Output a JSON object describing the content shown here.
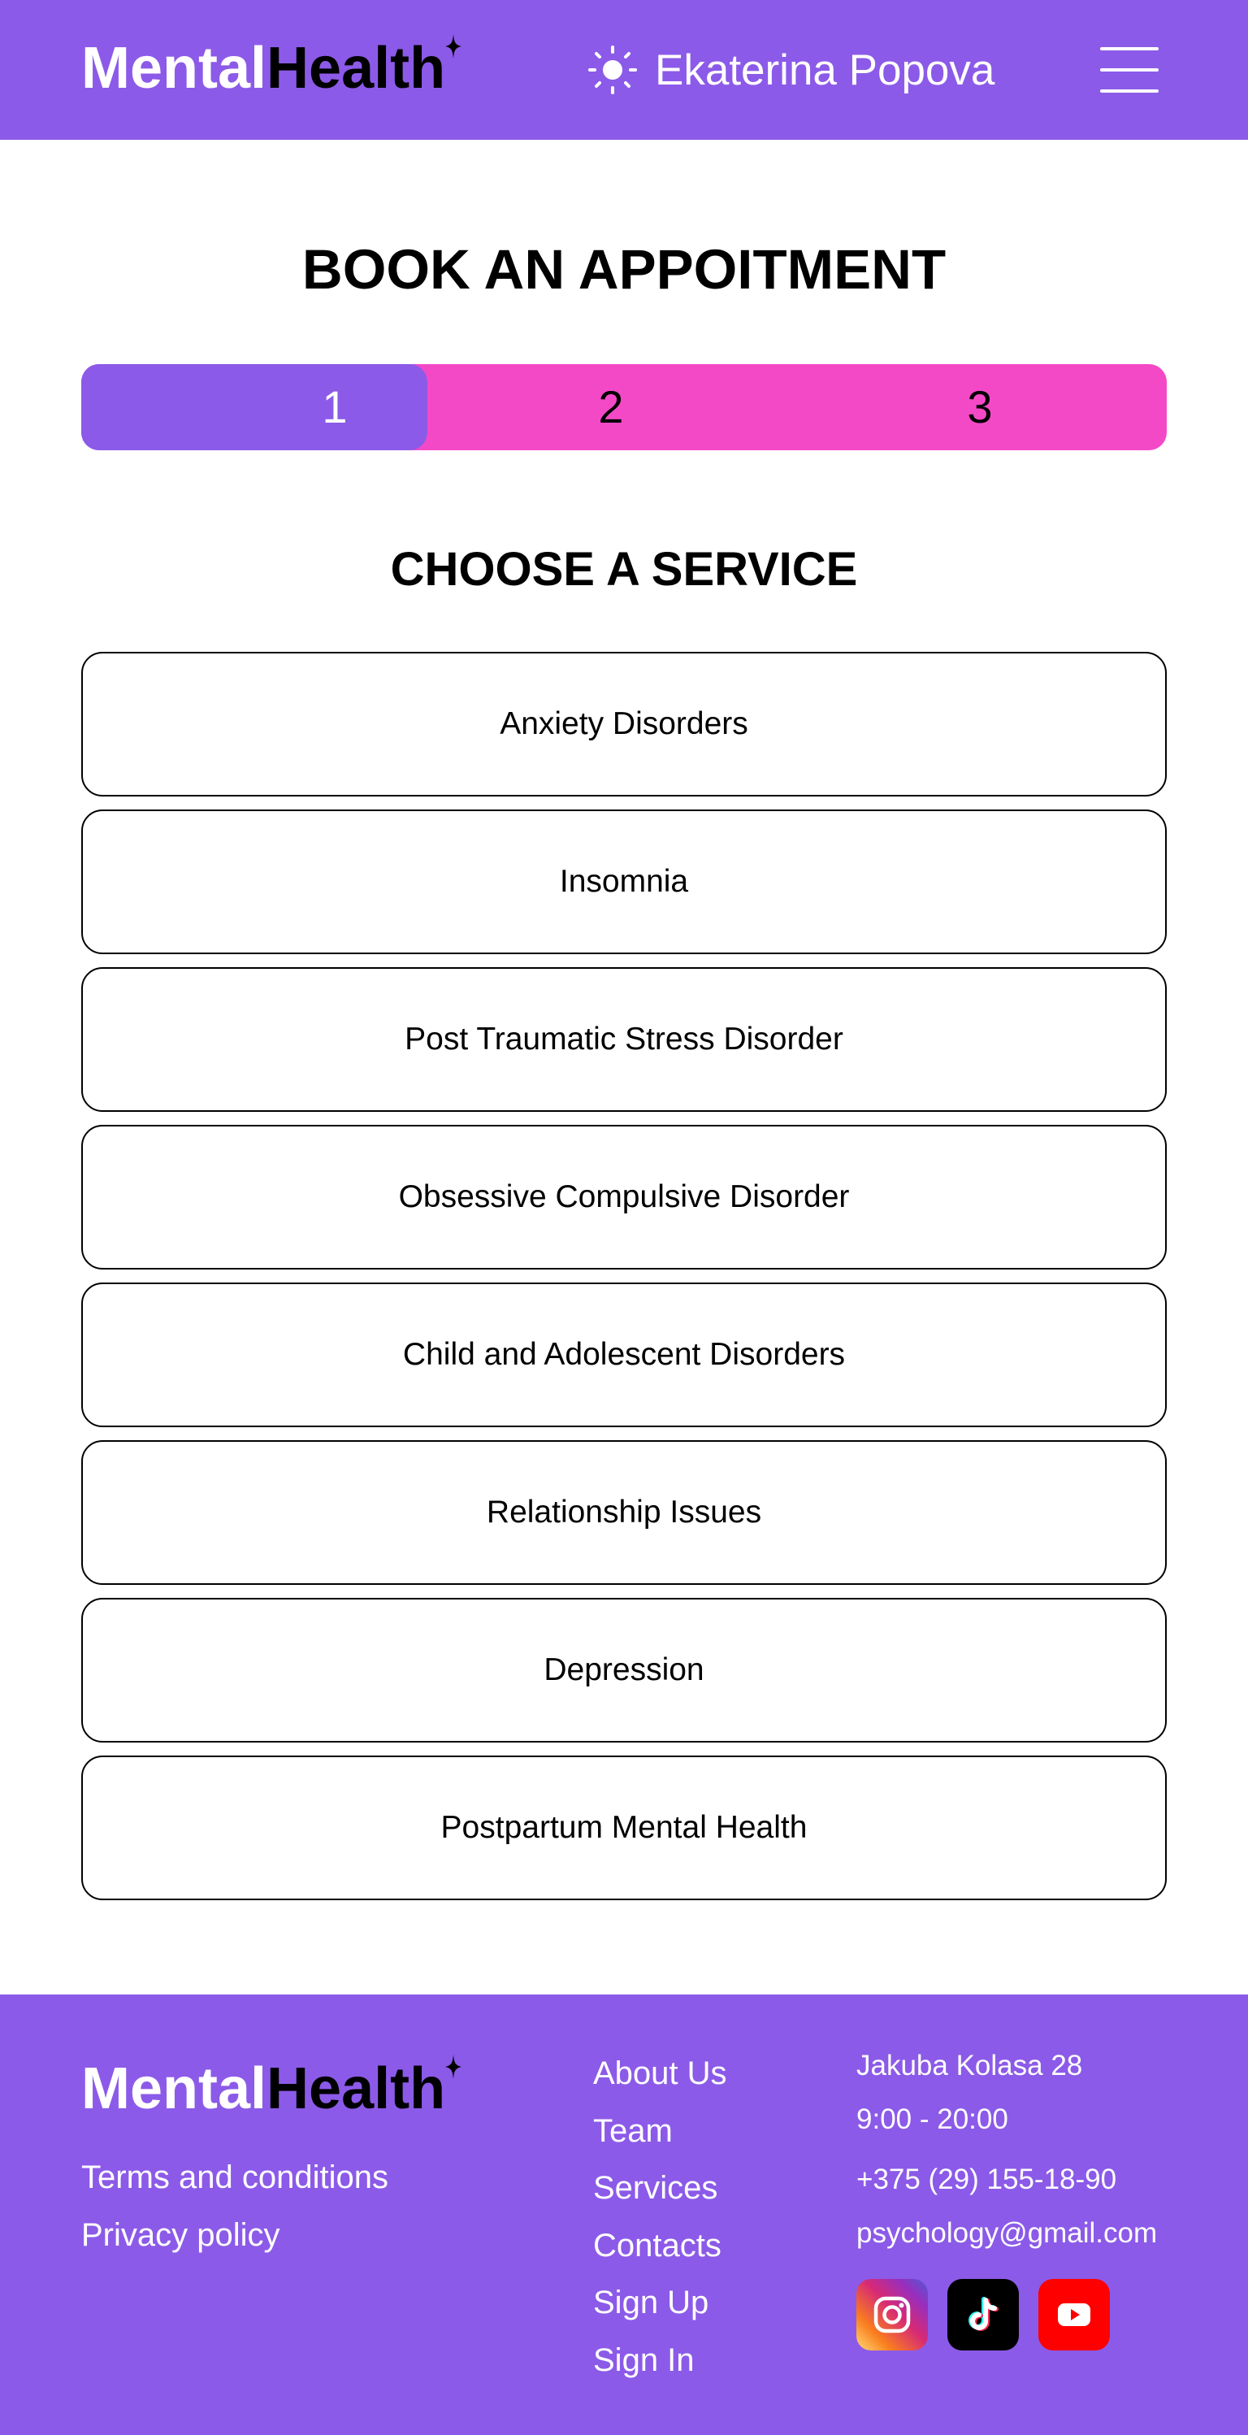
{
  "header": {
    "logo_part1": "Mental",
    "logo_part2": "Health",
    "theme_icon": "sun-icon",
    "user_name": "Ekaterina Popova",
    "menu_icon": "hamburger-menu-icon"
  },
  "main": {
    "title": "BOOK AN APPOITMENT",
    "steps": [
      "1",
      "2",
      "3"
    ],
    "active_step": 1,
    "section_title": "CHOOSE A SERVICE",
    "services": [
      "Anxiety Disorders",
      "Insomnia",
      "Post Traumatic Stress Disorder",
      "Obsessive Compulsive Disorder",
      "Child and Adolescent Disorders",
      "Relationship Issues",
      "Depression",
      "Postpartum Mental Health"
    ]
  },
  "footer": {
    "logo_part1": "Mental",
    "logo_part2": "Health",
    "legal": [
      "Terms and conditions",
      "Privacy policy"
    ],
    "nav": [
      "About Us",
      "Team",
      "Services",
      "Contacts",
      "Sign Up",
      "Sign In"
    ],
    "address": "Jakuba Kolasa 28",
    "hours": "9:00 - 20:00",
    "phone": "+375 (29) 155-18-90",
    "email": "psychology@gmail.com",
    "socials": [
      "instagram-icon",
      "tiktok-icon",
      "youtube-icon"
    ]
  },
  "colors": {
    "primary_purple": "#8c5ae8",
    "accent_pink": "#f449c7",
    "text_dark": "#000000",
    "text_light": "#ffffff"
  }
}
